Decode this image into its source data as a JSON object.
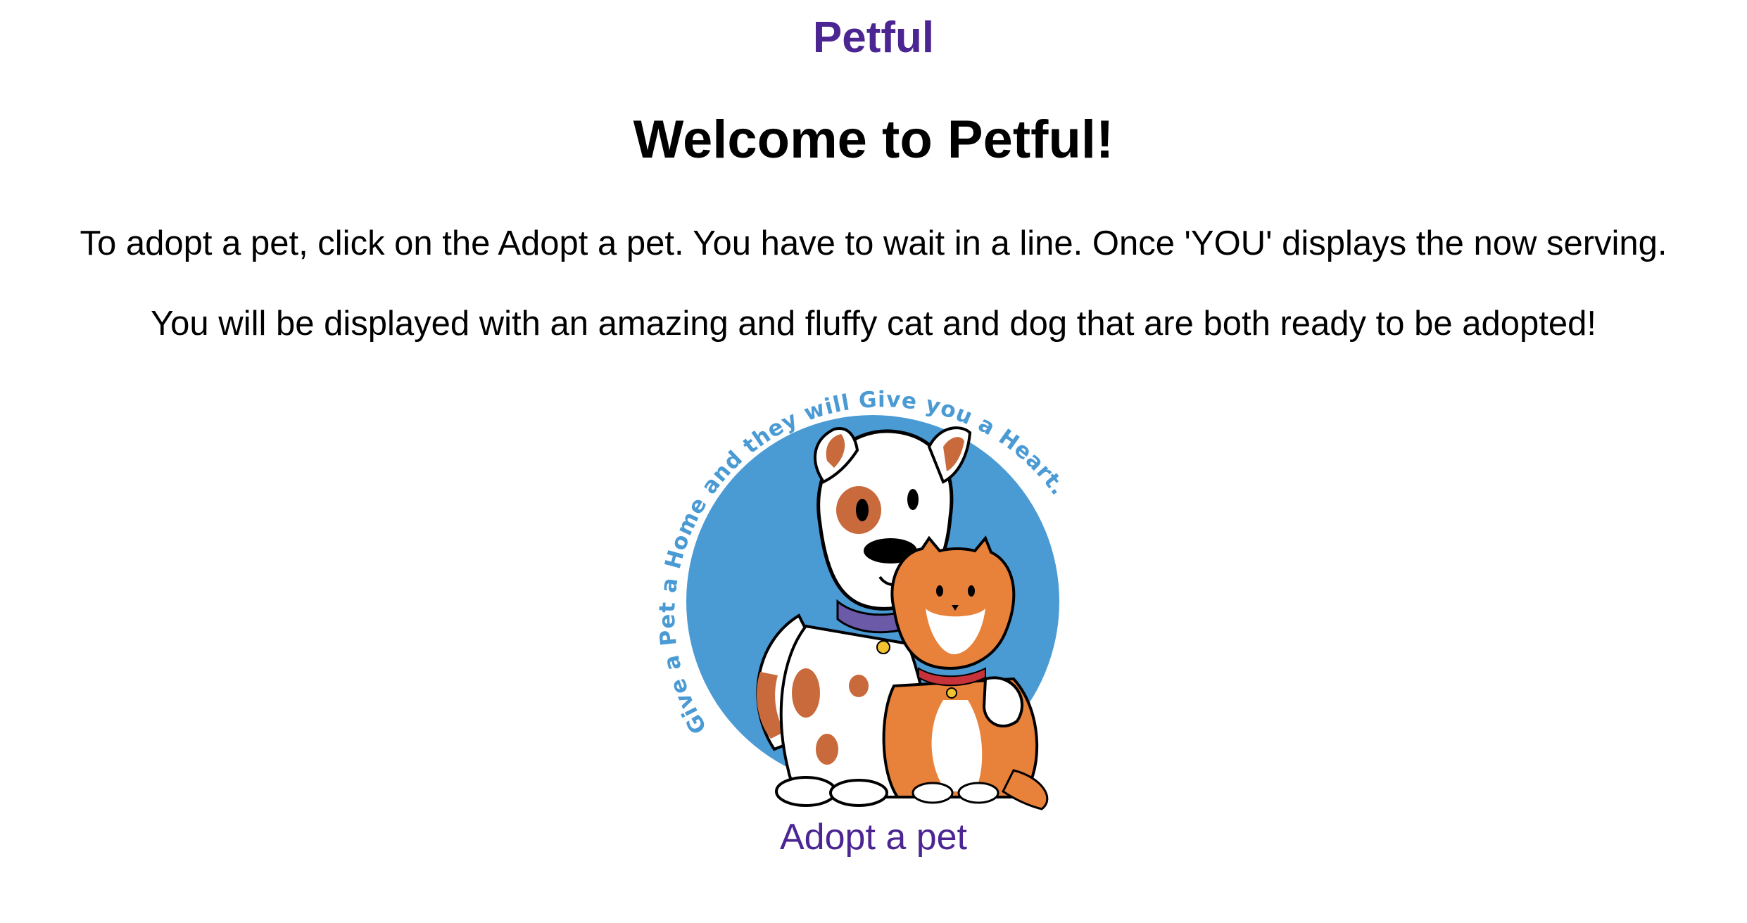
{
  "header": {
    "brand": "Petful"
  },
  "main": {
    "title": "Welcome to Petful!",
    "paragraphs": [
      "To adopt a pet, click on the Adopt a pet. You have to wait in a line. Once 'YOU' displays the now serving.",
      "You will be displayed with an amazing and fluffy cat and dog that are both ready to be adopted!"
    ],
    "logo": {
      "arc_text": "Give a Pet a Home and they will Give you a Heart.",
      "icon": "dog-and-cat-logo",
      "colors": {
        "circle": "#4a9ad4",
        "dog_spots": "#c86a3c",
        "cat_fur": "#e8813a",
        "dog_collar": "#6a5aa8",
        "cat_collar": "#c8323a"
      }
    },
    "adopt_link": "Adopt a pet"
  },
  "colors": {
    "accent": "#4b2591",
    "text": "#000000",
    "background": "#ffffff"
  }
}
